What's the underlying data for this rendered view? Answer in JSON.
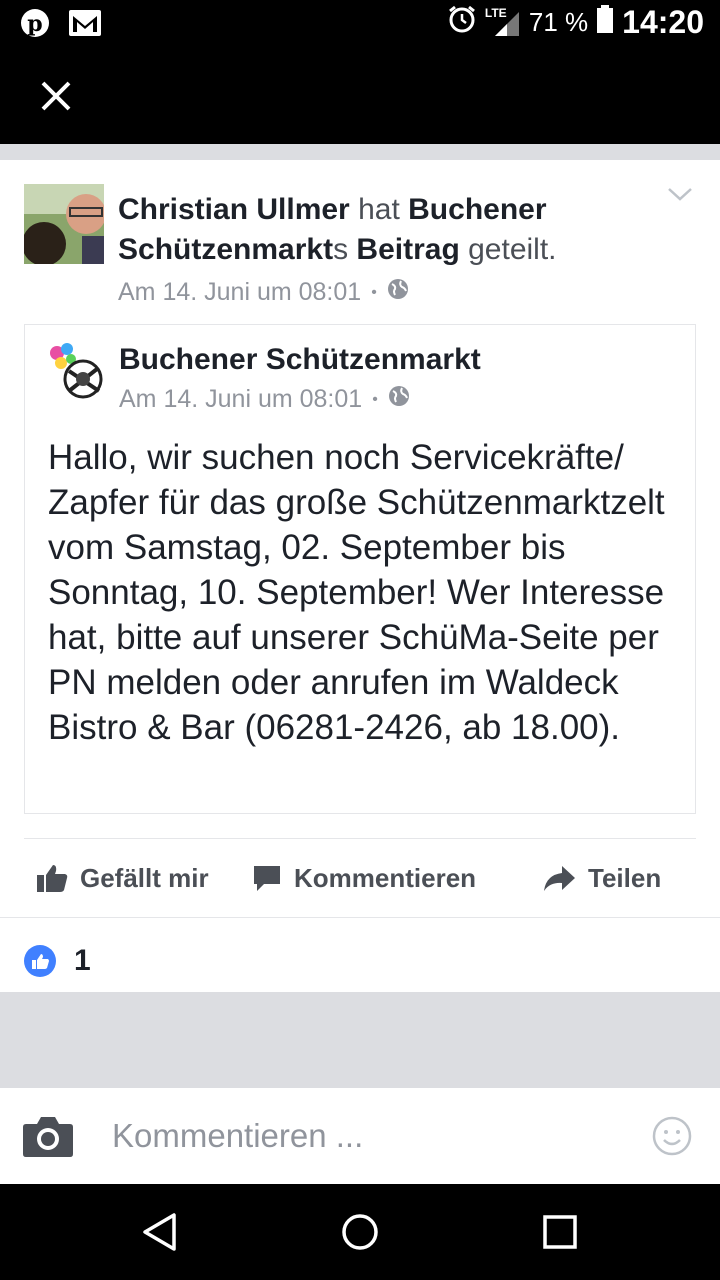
{
  "status_bar": {
    "network": "LTE",
    "battery_percent": "71 %",
    "time": "14:20"
  },
  "post": {
    "author": "Christian Ullmer",
    "verb_hat": "hat",
    "page_name_part": "Buchener Schützenmarkt",
    "possessive_s": "s",
    "beitrag": "Beitrag",
    "geteilt": "geteilt.",
    "timestamp": "Am 14. Juni um 08:01",
    "separator": "•"
  },
  "shared_post": {
    "name": "Buchener Schützenmarkt",
    "timestamp": "Am 14. Juni um 08:01",
    "separator": "•",
    "body": "Hallo, wir suchen noch Servicekräfte/ Zapfer für das große Schützenmarktzelt vom Samstag, 02. September bis Sonntag, 10. September! Wer Interesse hat, bitte auf unserer SchüMa-Seite per PN melden oder anrufen im Waldeck Bistro & Bar (06281-2426, ab 18.00)."
  },
  "actions": {
    "like": "Gefällt mir",
    "comment": "Kommentieren",
    "share": "Teilen"
  },
  "reactions": {
    "like_count": "1"
  },
  "comment_bar": {
    "placeholder": "Kommentieren ..."
  },
  "colors": {
    "facebook_blue": "#4080ff",
    "text_primary": "#1d2129",
    "text_secondary": "#90949c",
    "action_gray": "#4b4f56"
  }
}
